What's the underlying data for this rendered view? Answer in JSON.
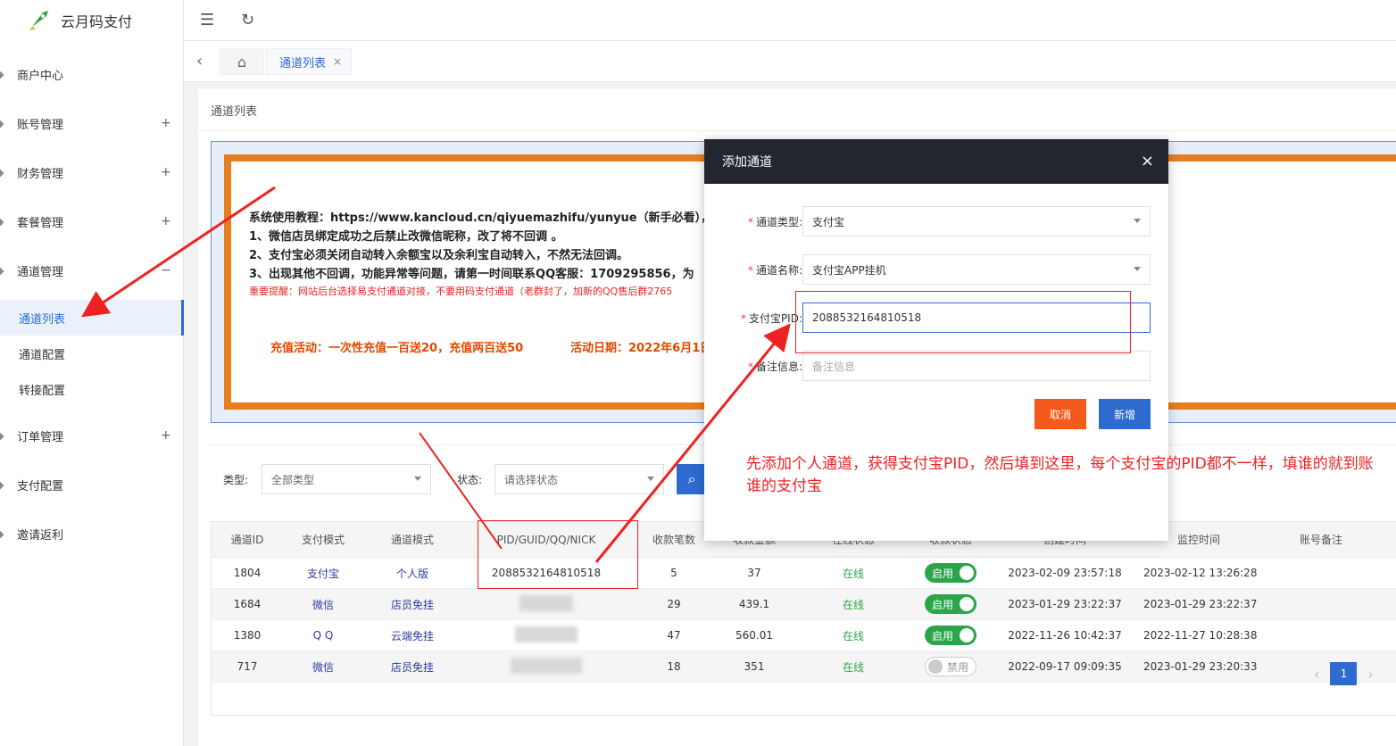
{
  "brand": {
    "name": "云月码支付"
  },
  "sidebar": {
    "items": [
      {
        "label": "商户中心",
        "expander": ""
      },
      {
        "label": "账号管理",
        "expander": "+"
      },
      {
        "label": "财务管理",
        "expander": "+"
      },
      {
        "label": "套餐管理",
        "expander": "+"
      },
      {
        "label": "通道管理",
        "expander": "−"
      },
      {
        "label": "订单管理",
        "expander": "+"
      },
      {
        "label": "支付配置",
        "expander": ""
      },
      {
        "label": "邀请返利",
        "expander": ""
      }
    ],
    "sub_items": [
      {
        "label": "通道列表"
      },
      {
        "label": "通道配置"
      },
      {
        "label": "转接配置"
      }
    ]
  },
  "tabs": {
    "active": "通道列表",
    "close": "×"
  },
  "page": {
    "breadcrumb": "通道列表"
  },
  "notice": {
    "line0": "系统使用教程：https://www.kancloud.cn/qiyuemazhifu/yunyue（新手必看），",
    "line1": "1、微信店员绑定成功之后禁止改微信昵称，改了将不回调 。",
    "line2": "2、支付宝必须关闭自动转入余额宝以及余利宝自动转入，不然无法回调。",
    "line3": "3、出现其他不回调，功能异常等问题，请第一时间联系QQ客服：1709295856，为",
    "warning": "重要提醒：网站后台选择易支付通道对接，不要用码支付通道（老群封了，加新的QQ售后群2765",
    "promo": "充值活动：一次性充值一百送20，充值两百送50",
    "date": "活动日期：2022年6月1日"
  },
  "filter": {
    "type_label": "类型:",
    "type_value": "全部类型",
    "status_label": "状态:",
    "status_placeholder": "请选择状态"
  },
  "table": {
    "headers": [
      "通道ID",
      "支付模式",
      "通道模式",
      "PID/GUID/QQ/NICK",
      "收款笔数",
      "收款金额",
      "在线状态",
      "收款状态",
      "创建时间",
      "监控时间",
      "账号备注"
    ],
    "rows": [
      {
        "id": "1804",
        "pay": "支付宝",
        "mode": "个人版",
        "pid": "2088532164810518",
        "count": "5",
        "amount": "37",
        "online": "在线",
        "toggle": "启用",
        "toggle_on": true,
        "created": "2023-02-09 23:57:18",
        "monitor": "2023-02-12 13:26:28"
      },
      {
        "id": "1684",
        "pay": "微信",
        "mode": "店员免挂",
        "pid": "",
        "count": "29",
        "amount": "439.1",
        "online": "在线",
        "toggle": "启用",
        "toggle_on": true,
        "created": "2023-01-29 23:22:37",
        "monitor": "2023-01-29 23:22:37"
      },
      {
        "id": "1380",
        "pay": "Q Q",
        "mode": "云端免挂",
        "pid": "",
        "count": "47",
        "amount": "560.01",
        "online": "在线",
        "toggle": "启用",
        "toggle_on": true,
        "created": "2022-11-26 10:42:37",
        "monitor": "2022-11-27 10:28:38"
      },
      {
        "id": "717",
        "pay": "微信",
        "mode": "店员免挂",
        "pid": "",
        "count": "18",
        "amount": "351",
        "online": "在线",
        "toggle": "禁用",
        "toggle_on": false,
        "created": "2022-09-17 09:09:35",
        "monitor": "2023-01-29 23:20:33"
      }
    ]
  },
  "pager": {
    "current": "1"
  },
  "modal": {
    "title": "添加通道",
    "close": "×",
    "fields": [
      {
        "label": "通道类型:",
        "value": "支付宝"
      },
      {
        "label": "通道名称:",
        "value": "支付宝APP挂机"
      },
      {
        "label": "支付宝PID:",
        "value": "2088532164810518"
      },
      {
        "label": "备注信息:",
        "placeholder": "备注信息"
      }
    ],
    "cancel": "取消",
    "submit": "新增"
  },
  "annotation": "先添加个人通道，获得支付宝PID，然后填到这里，每个支付宝的PID都不一样，填谁的就到账谁的支付宝",
  "colors": {
    "primary": "#2d6bce",
    "cancel": "#f35a1c",
    "notice_border": "#e67e22",
    "annotation": "#e22",
    "online": "#2aa54a"
  }
}
